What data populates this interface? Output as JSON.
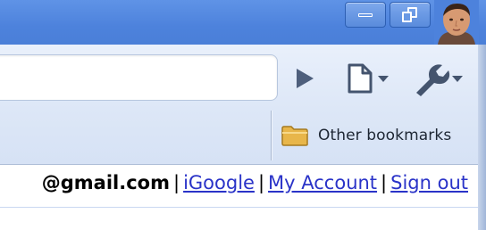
{
  "window": {
    "minimize_label": "Minimize",
    "restore_label": "Restore"
  },
  "toolbar": {
    "address_value": "",
    "go_icon": "play-triangle",
    "page_menu_icon": "page-icon",
    "wrench_menu_icon": "wrench-icon"
  },
  "bookmarks": {
    "other_bookmarks_label": "Other bookmarks",
    "folder_icon": "folder-icon"
  },
  "userbar": {
    "email": "@gmail.com",
    "separator": "|",
    "links": [
      "iGoogle",
      "My Account",
      "Sign out"
    ]
  },
  "colors": {
    "titlebar": "#4d82dc",
    "link": "#2a33c8",
    "toolbar": "#dde7f7"
  }
}
